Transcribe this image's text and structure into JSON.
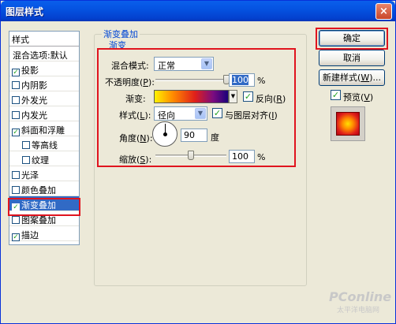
{
  "window": {
    "title": "图层样式",
    "close_label": "×"
  },
  "style_list": {
    "header": "样式",
    "items": [
      {
        "label": "混合选项:默认",
        "checkbox": false,
        "checked": false,
        "indent": false,
        "selected": false
      },
      {
        "label": "投影",
        "checkbox": true,
        "checked": true,
        "indent": false,
        "selected": false
      },
      {
        "label": "内阴影",
        "checkbox": true,
        "checked": false,
        "indent": false,
        "selected": false
      },
      {
        "label": "外发光",
        "checkbox": true,
        "checked": false,
        "indent": false,
        "selected": false
      },
      {
        "label": "内发光",
        "checkbox": true,
        "checked": false,
        "indent": false,
        "selected": false
      },
      {
        "label": "斜面和浮雕",
        "checkbox": true,
        "checked": true,
        "indent": false,
        "selected": false
      },
      {
        "label": "等高线",
        "checkbox": true,
        "checked": false,
        "indent": true,
        "selected": false
      },
      {
        "label": "纹理",
        "checkbox": true,
        "checked": false,
        "indent": true,
        "selected": false
      },
      {
        "label": "光泽",
        "checkbox": true,
        "checked": false,
        "indent": false,
        "selected": false
      },
      {
        "label": "颜色叠加",
        "checkbox": true,
        "checked": false,
        "indent": false,
        "selected": false
      },
      {
        "label": "渐变叠加",
        "checkbox": true,
        "checked": true,
        "indent": false,
        "selected": true
      },
      {
        "label": "图案叠加",
        "checkbox": true,
        "checked": false,
        "indent": false,
        "selected": false
      },
      {
        "label": "描边",
        "checkbox": true,
        "checked": true,
        "indent": false,
        "selected": false
      }
    ]
  },
  "panel": {
    "group_title": "渐变叠加",
    "sub_title": "渐变",
    "blend_mode": {
      "label": "混合模式:",
      "value": "正常"
    },
    "opacity": {
      "label_prefix": "不透明度(",
      "label_key": "P",
      "label_suffix": "):",
      "value": "100",
      "unit": "%",
      "level": 1.0
    },
    "gradient": {
      "label": "渐变:",
      "reverse_label_prefix": "反向(",
      "reverse_key": "R",
      "reverse_label_suffix": ")",
      "reverse_checked": true
    },
    "style": {
      "label_prefix": "样式(",
      "label_key": "L",
      "label_suffix": "):",
      "value": "径向",
      "align_label_prefix": "与图层对齐(",
      "align_key": "I",
      "align_label_suffix": ")",
      "align_checked": true
    },
    "angle": {
      "label_prefix": "角度(",
      "label_key": "N",
      "label_suffix": "):",
      "value": "90",
      "unit": "度"
    },
    "scale": {
      "label_prefix": "缩放(",
      "label_key": "S",
      "label_suffix": "):",
      "value": "100",
      "unit": "%",
      "level": 0.5
    }
  },
  "buttons": {
    "ok": "确定",
    "cancel": "取消",
    "new_style_prefix": "新建样式(",
    "new_style_key": "W",
    "new_style_suffix": ")...",
    "preview_prefix": "预览(",
    "preview_key": "V",
    "preview_suffix": ")",
    "preview_checked": true
  },
  "watermark": {
    "brand": "PConline",
    "sub": "太平洋电脑网"
  },
  "colors": {
    "highlight": "#E0141E",
    "selection": "#316AC5",
    "titlebar": "#0553E1"
  },
  "icons": {
    "close": "close-icon",
    "dropdown": "chevron-down-icon",
    "checkmark": "check-icon"
  }
}
